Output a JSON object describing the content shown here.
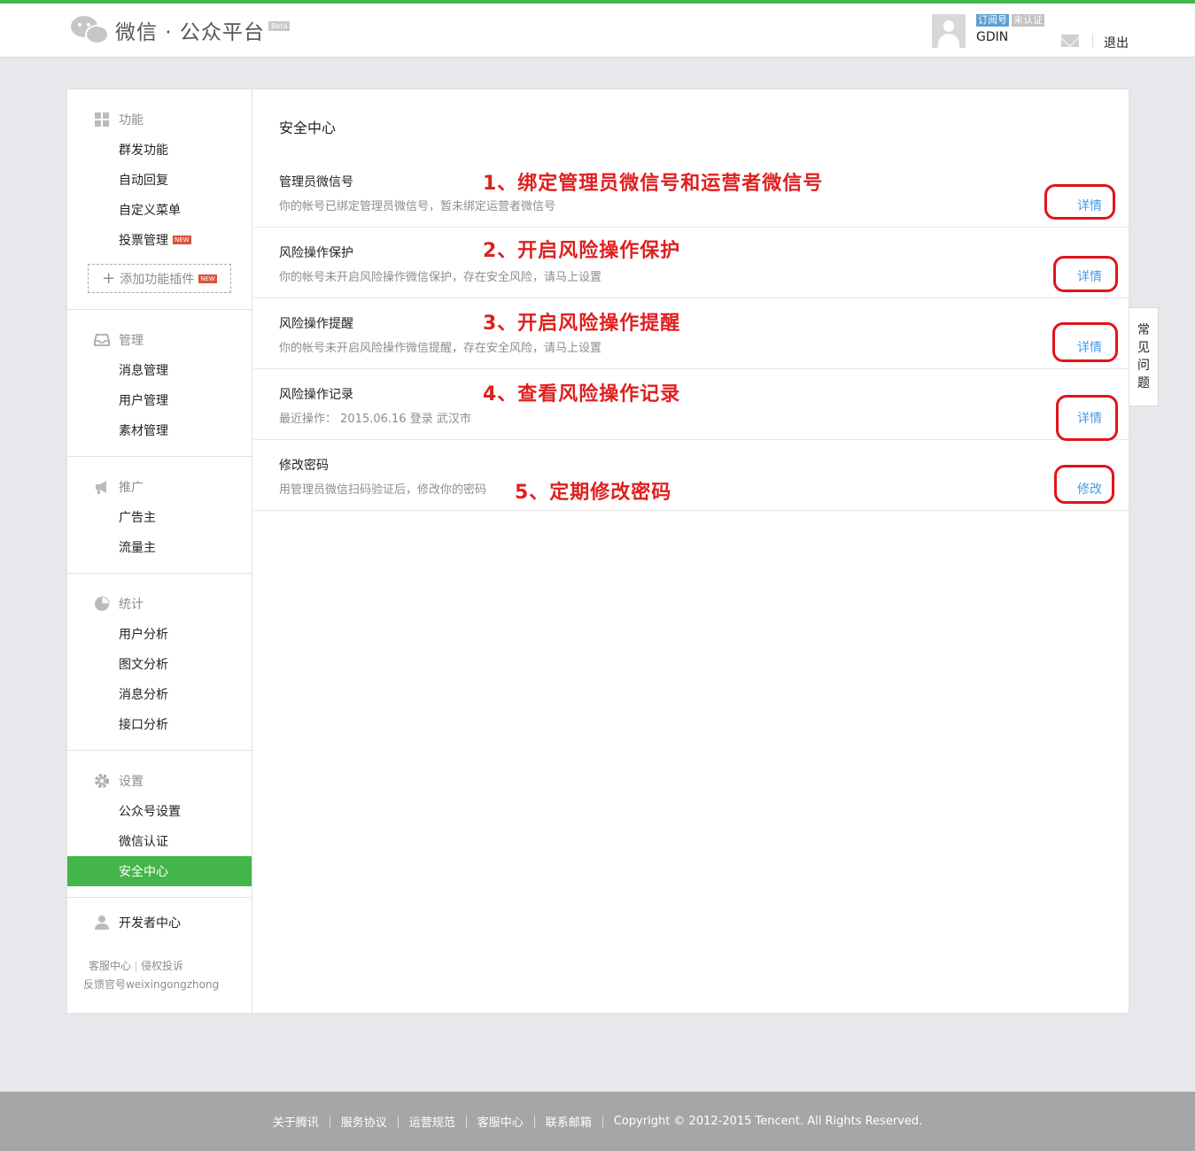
{
  "header": {
    "logo_text": "微信 · 公众平台",
    "beta": "Beta",
    "account_type": "订阅号",
    "auth_status": "未认证",
    "username": "GDIN",
    "logout": "退出"
  },
  "sidebar": {
    "sections": [
      {
        "title": "功能",
        "items": [
          "群发功能",
          "自动回复",
          "自定义菜单",
          "投票管理"
        ],
        "new_badge": "NEW",
        "add_plugin": "添加功能插件"
      },
      {
        "title": "管理",
        "items": [
          "消息管理",
          "用户管理",
          "素材管理"
        ]
      },
      {
        "title": "推广",
        "items": [
          "广告主",
          "流量主"
        ]
      },
      {
        "title": "统计",
        "items": [
          "用户分析",
          "图文分析",
          "消息分析",
          "接口分析"
        ]
      },
      {
        "title": "设置",
        "items": [
          "公众号设置",
          "微信认证",
          "安全中心"
        ]
      }
    ],
    "developer": "开发者中心",
    "footer_links": [
      "客服中心",
      "侵权投诉"
    ],
    "footer_text": "反馈官号weixingongzhong"
  },
  "main": {
    "page_title": "安全中心",
    "items": [
      {
        "title": "管理员微信号",
        "desc": "你的帐号已绑定管理员微信号，暂未绑定运营者微信号",
        "action": "详情",
        "annotation": "1、绑定管理员微信号和运营者微信号"
      },
      {
        "title": "风险操作保护",
        "desc": "你的帐号未开启风险操作微信保护，存在安全风险，请马上设置",
        "action": "详情",
        "annotation": "2、开启风险操作保护"
      },
      {
        "title": "风险操作提醒",
        "desc": "你的帐号未开启风险操作微信提醒，存在安全风险，请马上设置",
        "action": "详情",
        "annotation": "3、开启风险操作提醒"
      },
      {
        "title": "风险操作记录",
        "desc": "最近操作：  2015.06.16    登录    武汉市",
        "action": "详情",
        "annotation": "4、查看风险操作记录"
      },
      {
        "title": "修改密码",
        "desc": "用管理员微信扫码验证后，修改你的密码",
        "action": "修改",
        "annotation": "5、定期修改密码"
      }
    ]
  },
  "faq": {
    "chars": [
      "常",
      "见",
      "问",
      "题"
    ]
  },
  "footer": {
    "links": [
      "关于腾讯",
      "服务协议",
      "运营规范",
      "客服中心",
      "联系邮箱"
    ],
    "copyright": "Copyright © 2012-2015 Tencent. All Rights Reserved."
  },
  "colors": {
    "brand_green": "#44b549",
    "link_blue": "#459ae9",
    "annotation_red": "#e02020"
  }
}
